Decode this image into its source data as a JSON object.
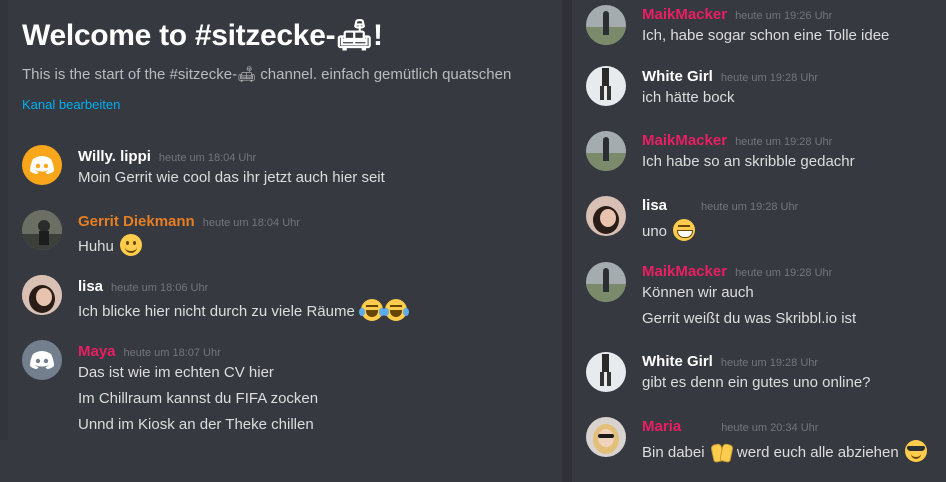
{
  "channel": {
    "welcome_title": "Welcome to #sitzecke-🛋!",
    "welcome_subtitle": "This is the start of the #sitzecke-🛋 channel. einfach gemütlich quatschen",
    "edit_link": "Kanal bearbeiten"
  },
  "colors": {
    "background": "#36393f",
    "author_white": "#ffffff",
    "author_orange": "#e67e22",
    "author_pink": "#e91e63",
    "timestamp": "#72767d",
    "link": "#00b0f4"
  },
  "left_messages": [
    {
      "author": "Willy. lippi",
      "timestamp": "heute um 18:04 Uhr",
      "lines": [
        "Moin Gerrit wie cool das ihr jetzt auch hier seit"
      ],
      "avatar": "discord-logo-orange"
    },
    {
      "author": "Gerrit Diekmann",
      "timestamp": "heute um 18:04 Uhr",
      "lines": [
        "Huhu"
      ],
      "avatar": "photo"
    },
    {
      "author": "lisa",
      "timestamp": "heute um 18:06 Uhr",
      "lines": [
        "Ich blicke hier nicht durch zu viele Räume"
      ],
      "avatar": "photo"
    },
    {
      "author": "Maya",
      "timestamp": "heute um 18:07 Uhr",
      "lines": [
        "Das ist wie im echten CV hier",
        "Im Chillraum kannst du FIFA zocken",
        "Unnd im Kiosk an der Theke chillen"
      ],
      "avatar": "discord-logo-grey"
    }
  ],
  "right_messages": [
    {
      "author": "MaikMacker",
      "timestamp": "heute um 19:26 Uhr",
      "lines": [
        "Ich, habe sogar schon eine Tolle idee"
      ],
      "avatar": "photo"
    },
    {
      "author": "White Girl",
      "timestamp": "heute um 19:28 Uhr",
      "lines": [
        "ich hätte bock"
      ],
      "avatar": "photo"
    },
    {
      "author": "MaikMacker",
      "timestamp": "heute um 19:28 Uhr",
      "lines": [
        "Ich habe so an skribble gedachr"
      ],
      "avatar": "photo"
    },
    {
      "author": "lisa",
      "timestamp": "heute um 19:28 Uhr",
      "lines": [
        "uno"
      ],
      "avatar": "photo"
    },
    {
      "author": "MaikMacker",
      "timestamp": "heute um 19:28 Uhr",
      "lines": [
        "Können wir auch",
        "Gerrit weißt du was Skribbl.io ist"
      ],
      "avatar": "photo"
    },
    {
      "author": "White Girl",
      "timestamp": "heute um 19:28 Uhr",
      "lines": [
        "gibt es denn ein gutes uno online?"
      ],
      "avatar": "photo"
    },
    {
      "author": "Maria",
      "timestamp": "heute um 20:34 Uhr",
      "lines": [
        "Bin dabei",
        "werd euch alle abziehen"
      ],
      "avatar": "photo"
    }
  ]
}
